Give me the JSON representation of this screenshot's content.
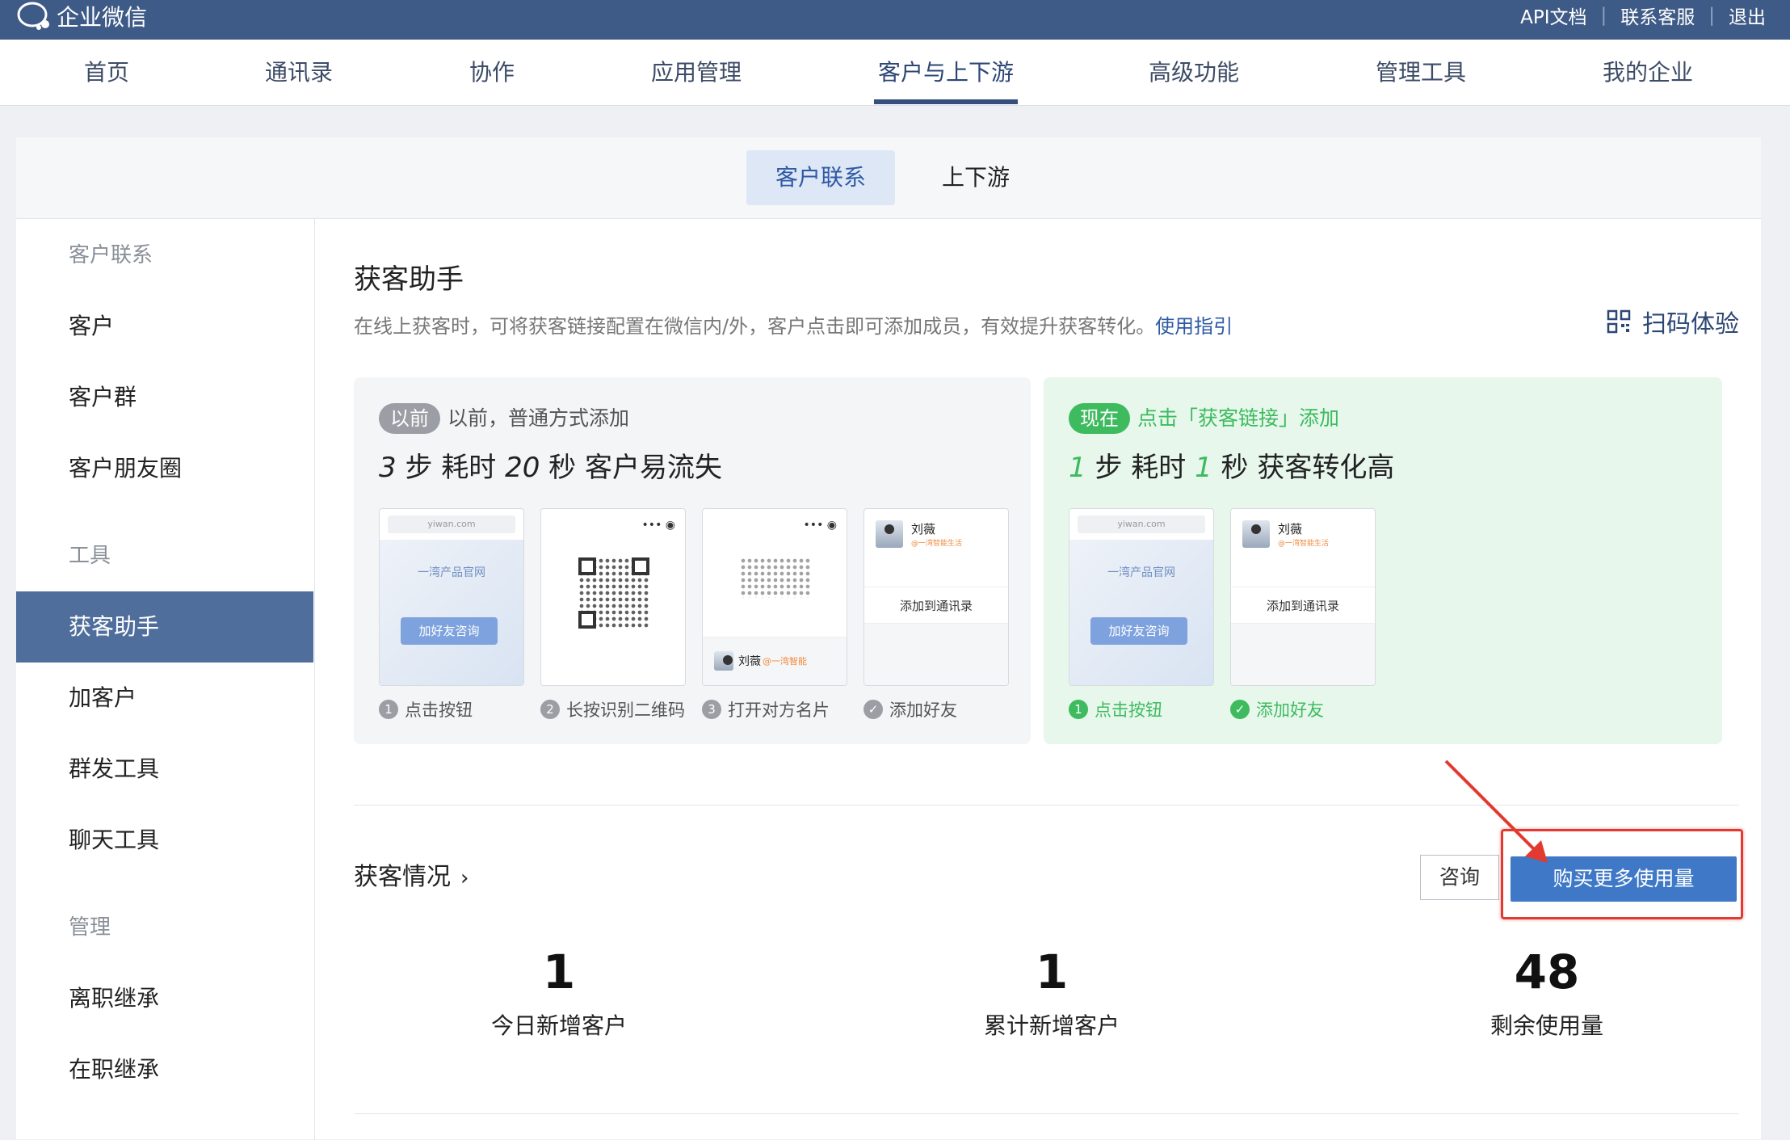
{
  "topbar": {
    "logo_text": "企业微信",
    "links": [
      "API文档",
      "联系客服",
      "退出"
    ]
  },
  "nav": {
    "items": [
      "首页",
      "通讯录",
      "协作",
      "应用管理",
      "客户与上下游",
      "高级功能",
      "管理工具",
      "我的企业"
    ],
    "active": "客户与上下游"
  },
  "subtabs": {
    "items": [
      "客户联系",
      "上下游"
    ],
    "active": "客户联系"
  },
  "sidebar": {
    "items": [
      {
        "label": "客户联系",
        "type": "group"
      },
      {
        "label": "客户",
        "type": "item"
      },
      {
        "label": "客户群",
        "type": "item"
      },
      {
        "label": "客户朋友圈",
        "type": "item"
      },
      {
        "label": "工具",
        "type": "group"
      },
      {
        "label": "获客助手",
        "type": "active"
      },
      {
        "label": "加客户",
        "type": "item"
      },
      {
        "label": "群发工具",
        "type": "item"
      },
      {
        "label": "聊天工具",
        "type": "item"
      },
      {
        "label": "管理",
        "type": "group"
      },
      {
        "label": "离职继承",
        "type": "item"
      },
      {
        "label": "在职继承",
        "type": "item"
      }
    ]
  },
  "page": {
    "title": "获客助手",
    "description": "在线上获客时，可将获客链接配置在微信内/外，客户点击即可添加成员，有效提升获客转化。",
    "guide_link": "使用指引",
    "scan_label": "扫码体验"
  },
  "before": {
    "badge": "以前",
    "text": "以前，普通方式添加",
    "head": {
      "n1": "3",
      "t1": " 步  耗时 ",
      "n2": "20",
      "t2": " 秒  客户易流失"
    },
    "steps": [
      "点击按钮",
      "长按识别二维码",
      "打开对方名片",
      "添加好友"
    ]
  },
  "now": {
    "badge": "现在",
    "text": "点击「获客链接」添加",
    "head": {
      "n1": "1",
      "t1": " 步  耗时 ",
      "n2": "1",
      "t2": " 秒  获客转化高"
    },
    "steps": [
      "点击按钮",
      "添加好友"
    ]
  },
  "mock": {
    "url": "yiwan.com",
    "site_title": "一湾产品官网",
    "button": "加好友咨询",
    "person": "刘薇",
    "person_sub": "@一湾智能生活",
    "person_company": "@一湾智能",
    "add_contact": "添加到通讯录"
  },
  "stats": {
    "heading": "获客情况",
    "consult": "咨询",
    "buy": "购买更多使用量",
    "items": [
      {
        "value": "1",
        "label": "今日新增客户"
      },
      {
        "value": "1",
        "label": "累计新增客户"
      },
      {
        "value": "48",
        "label": "剩余使用量"
      }
    ]
  },
  "colors": {
    "topbar": "#3e5a86",
    "active_sidebar": "#4f6e9c",
    "buy_button": "#3e78c7",
    "now_green": "#3dbb5e",
    "before_gray": "#9b9ea4",
    "highlight": "#e23a31"
  }
}
